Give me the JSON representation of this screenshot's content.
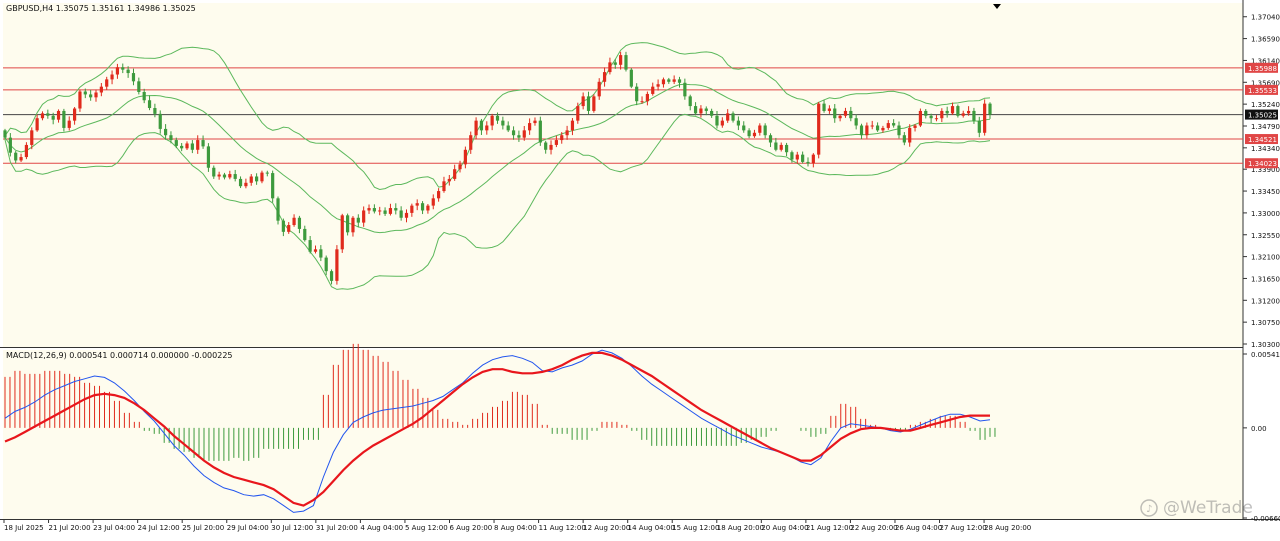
{
  "header": {
    "main_label": "GBPUSD,H4  1.35075 1.35161 1.34986 1.35025",
    "macd_label": "MACD(12,26,9) 0.000541 0.000714 0.000000 -0.000225"
  },
  "watermark": {
    "text": "@WeTrade"
  },
  "colors": {
    "chart_bg": "#fefcee",
    "bull": "#e02a1c",
    "bear": "#3d9a3d",
    "band": "#5cb85c",
    "level": "#e04646",
    "price_line": "#444444",
    "macd_line": "#2255ee",
    "signal_line": "#e8161c"
  },
  "price_axis": {
    "ticks": [
      "1.37040",
      "1.36590",
      "1.36140",
      "1.35690",
      "1.35240",
      "1.34790",
      "1.34340",
      "1.33900",
      "1.33450",
      "1.33000",
      "1.32550",
      "1.32100",
      "1.31650",
      "1.31200",
      "1.30750",
      "1.30300"
    ],
    "tags": [
      {
        "label": "1.35988",
        "type": "level"
      },
      {
        "label": "1.35533",
        "type": "level"
      },
      {
        "label": "1.35025",
        "type": "current"
      },
      {
        "label": "1.34521",
        "type": "level"
      },
      {
        "label": "1.34023",
        "type": "level"
      }
    ]
  },
  "macd_axis": {
    "ticks": [
      "0.005416",
      "0.00",
      "-0.006609"
    ]
  },
  "time_axis": {
    "labels": [
      "18 Jul 2025",
      "21 Jul 20:00",
      "23 Jul 04:00",
      "24 Jul 12:00",
      "25 Jul 20:00",
      "29 Jul 04:00",
      "30 Jul 12:00",
      "31 Jul 20:00",
      "4 Aug 04:00",
      "5 Aug 12:00",
      "6 Aug 20:00",
      "8 Aug 04:00",
      "11 Aug 12:00",
      "12 Aug 20:00",
      "14 Aug 04:00",
      "15 Aug 12:00",
      "18 Aug 20:00",
      "20 Aug 04:00",
      "21 Aug 12:00",
      "22 Aug 20:00",
      "26 Aug 04:00",
      "27 Aug 12:00",
      "28 Aug 20:00"
    ]
  },
  "chart_data": {
    "type": "candlestick",
    "symbol": "GBPUSD",
    "timeframe": "H4",
    "ohlc_last": {
      "open": 1.35075,
      "high": 1.35161,
      "low": 1.34986,
      "close": 1.35025
    },
    "ylim": [
      1.303,
      1.3722
    ],
    "horizontal_levels": [
      1.35988,
      1.35533,
      1.34521,
      1.34023
    ],
    "current_price": 1.35025,
    "closes": [
      1.3455,
      1.3424,
      1.3408,
      1.3415,
      1.344,
      1.347,
      1.3495,
      1.3505,
      1.35,
      1.3492,
      1.351,
      1.3475,
      1.349,
      1.3515,
      1.355,
      1.3544,
      1.3538,
      1.3548,
      1.356,
      1.3575,
      1.3585,
      1.36,
      1.3595,
      1.3588,
      1.3571,
      1.3549,
      1.3532,
      1.3516,
      1.3504,
      1.3473,
      1.346,
      1.345,
      1.3438,
      1.3433,
      1.3443,
      1.343,
      1.345,
      1.3437,
      1.3393,
      1.3375,
      1.3379,
      1.3373,
      1.338,
      1.337,
      1.3355,
      1.3362,
      1.3375,
      1.3365,
      1.3383,
      1.3382,
      1.333,
      1.3284,
      1.3261,
      1.3275,
      1.329,
      1.3267,
      1.3244,
      1.322,
      1.3225,
      1.3208,
      1.318,
      1.316,
      1.3225,
      1.3295,
      1.326,
      1.329,
      1.328,
      1.3305,
      1.331,
      1.3303,
      1.3305,
      1.3298,
      1.331,
      1.3305,
      1.329,
      1.33,
      1.3315,
      1.332,
      1.3305,
      1.3315,
      1.333,
      1.3345,
      1.3365,
      1.337,
      1.339,
      1.34,
      1.343,
      1.346,
      1.349,
      1.347,
      1.348,
      1.35,
      1.349,
      1.348,
      1.347,
      1.346,
      1.3455,
      1.347,
      1.3485,
      1.349,
      1.3445,
      1.343,
      1.344,
      1.345,
      1.346,
      1.347,
      1.349,
      1.352,
      1.354,
      1.351,
      1.354,
      1.357,
      1.359,
      1.361,
      1.3605,
      1.3625,
      1.3595,
      1.356,
      1.353,
      1.353,
      1.3545,
      1.356,
      1.3565,
      1.3575,
      1.357,
      1.3575,
      1.3568,
      1.354,
      1.352,
      1.3505,
      1.3515,
      1.351,
      1.35,
      1.348,
      1.349,
      1.3505,
      1.349,
      1.348,
      1.347,
      1.3458,
      1.3465,
      1.348,
      1.346,
      1.3445,
      1.343,
      1.344,
      1.3425,
      1.341,
      1.342,
      1.3405,
      1.3402,
      1.342,
      1.3525,
      1.351,
      1.3515,
      1.3495,
      1.35,
      1.351,
      1.3495,
      1.348,
      1.346,
      1.348,
      1.348,
      1.347,
      1.3475,
      1.3485,
      1.348,
      1.346,
      1.3445,
      1.3475,
      1.348,
      1.351,
      1.35,
      1.3495,
      1.3495,
      1.351,
      1.3505,
      1.352,
      1.35,
      1.3505,
      1.351,
      1.349,
      1.3465,
      1.3525,
      1.35025
    ],
    "series": [
      {
        "name": "MACD",
        "values": [
          0.0007,
          0.0012,
          0.0015,
          0.0019,
          0.0024,
          0.0028,
          0.0031,
          0.0034,
          0.0036,
          0.0038,
          0.0037,
          0.0033,
          0.0027,
          0.002,
          0.0012,
          0.0005,
          -0.0004,
          -0.0013,
          -0.002,
          -0.0028,
          -0.0035,
          -0.004,
          -0.0044,
          -0.0046,
          -0.0049,
          -0.005,
          -0.0049,
          -0.0052,
          -0.0057,
          -0.0062,
          -0.0061,
          -0.0057,
          -0.0036,
          -0.0018,
          -0.0005,
          0.0004,
          0.0008,
          0.0011,
          0.0013,
          0.0014,
          0.0015,
          0.0016,
          0.0018,
          0.002,
          0.0023,
          0.0028,
          0.0033,
          0.004,
          0.0046,
          0.005,
          0.0052,
          0.0053,
          0.0051,
          0.0048,
          0.0042,
          0.0041,
          0.0044,
          0.0046,
          0.0049,
          0.0054,
          0.0057,
          0.0055,
          0.0051,
          0.0045,
          0.0038,
          0.0032,
          0.0027,
          0.0022,
          0.0017,
          0.0012,
          0.0007,
          0.0003,
          -0.0001,
          -0.0005,
          -0.0008,
          -0.0011,
          -0.0014,
          -0.0016,
          -0.0018,
          -0.0021,
          -0.0025,
          -0.0027,
          -0.0022,
          -0.001,
          0.0,
          0.0003,
          0.0002,
          0.0001,
          0.0,
          -0.0002,
          -0.0003,
          -0.0001,
          0.0002,
          0.0005,
          0.0008,
          0.001,
          0.001,
          0.0008,
          0.0005,
          0.0006
        ]
      },
      {
        "name": "Signal",
        "values": [
          -0.001,
          -0.0007,
          -0.0003,
          0.0001,
          0.0005,
          0.0009,
          0.0013,
          0.0017,
          0.0021,
          0.0024,
          0.0025,
          0.0024,
          0.0022,
          0.0018,
          0.0013,
          0.0007,
          0.0001,
          -0.0006,
          -0.0012,
          -0.0018,
          -0.0024,
          -0.0029,
          -0.0033,
          -0.0036,
          -0.0038,
          -0.004,
          -0.0042,
          -0.0045,
          -0.005,
          -0.0055,
          -0.0057,
          -0.0053,
          -0.0047,
          -0.0039,
          -0.0031,
          -0.0024,
          -0.0018,
          -0.0013,
          -0.0009,
          -0.0005,
          -0.0001,
          0.0003,
          0.0008,
          0.0014,
          0.002,
          0.0026,
          0.0032,
          0.0037,
          0.0041,
          0.0043,
          0.0043,
          0.0041,
          0.004,
          0.004,
          0.0041,
          0.0043,
          0.0046,
          0.005,
          0.0053,
          0.0055,
          0.0055,
          0.0053,
          0.005,
          0.0046,
          0.0042,
          0.0038,
          0.0033,
          0.0028,
          0.0023,
          0.0018,
          0.0013,
          0.0009,
          0.0005,
          0.0001,
          -0.0003,
          -0.0007,
          -0.0011,
          -0.0015,
          -0.0018,
          -0.0021,
          -0.0024,
          -0.0024,
          -0.002,
          -0.0014,
          -0.0008,
          -0.0004,
          -0.0001,
          0.0,
          0.0,
          -0.0001,
          -0.0002,
          -0.0002,
          0.0,
          0.0002,
          0.0004,
          0.0006,
          0.0008,
          0.0009,
          0.0009,
          0.0009
        ]
      }
    ],
    "macd_ylim": [
      -0.006609,
      0.005416
    ]
  }
}
